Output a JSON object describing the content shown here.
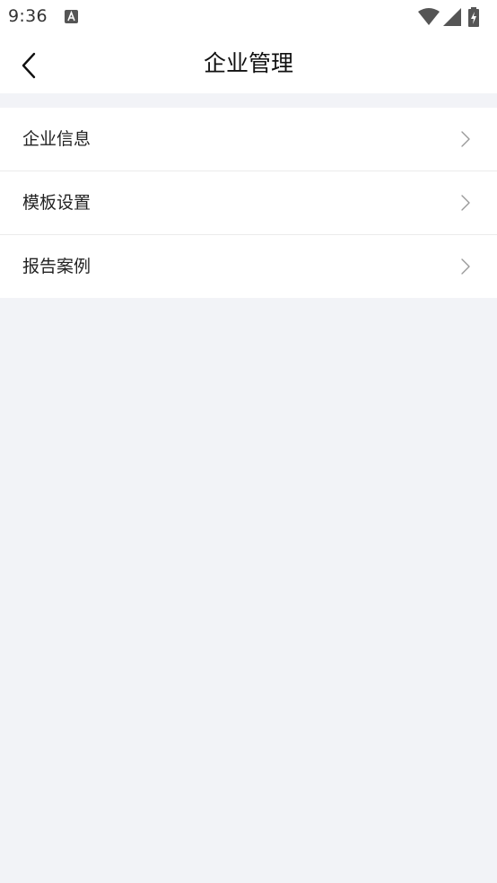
{
  "status_bar": {
    "time": "9:36",
    "icons": [
      "text-a-icon",
      "wifi-icon",
      "signal-icon",
      "battery-charging-icon"
    ]
  },
  "nav": {
    "title": "企业管理",
    "back_icon": "chevron-left-icon"
  },
  "menu": {
    "items": [
      {
        "label": "企业信息",
        "icon": "chevron-right-icon"
      },
      {
        "label": "模板设置",
        "icon": "chevron-right-icon"
      },
      {
        "label": "报告案例",
        "icon": "chevron-right-icon"
      }
    ]
  },
  "colors": {
    "background": "#f2f3f7",
    "surface": "#ffffff",
    "text": "#222222",
    "chevron": "#999999",
    "divider": "#ebebeb"
  }
}
